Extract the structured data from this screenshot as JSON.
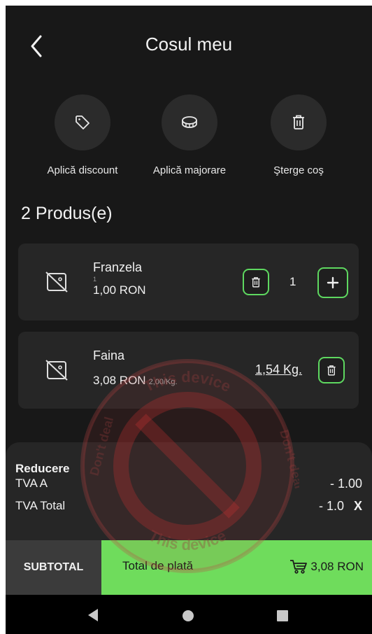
{
  "header": {
    "title": "Cosul meu"
  },
  "actions": [
    {
      "label": "Aplică discount",
      "icon": "tag-icon"
    },
    {
      "label": "Aplică majorare",
      "icon": "coin-icon"
    },
    {
      "label": "Şterge coş",
      "icon": "trash-icon"
    }
  ],
  "products_count": "2 Produs(e)",
  "products": [
    {
      "name": "Franzela",
      "sub": "1",
      "price": "1,00 RON",
      "quantity": "1"
    },
    {
      "name": "Faina",
      "price": "3,08 RON",
      "unit_price": "2,00/Kg.",
      "weight": "1,54 Kg."
    }
  ],
  "summary": {
    "reducere_label": "Reducere",
    "tva_a_label": "TVA A",
    "tva_a_value": "- 1.00",
    "tva_total_label": "TVA Total",
    "tva_total_value": "- 1.0",
    "remove_label": "X"
  },
  "footer": {
    "subtotal_label": "SUBTOTAL",
    "total_label": "Total de plată",
    "total_amount": "3,08 RON"
  },
  "watermark": {
    "text_top": "This device",
    "text_left": "Don't deal",
    "text_right": "Don't deal",
    "text_bottom": "This device"
  },
  "colors": {
    "accent": "#6fdc5c",
    "background": "#181818",
    "card": "#262626"
  }
}
